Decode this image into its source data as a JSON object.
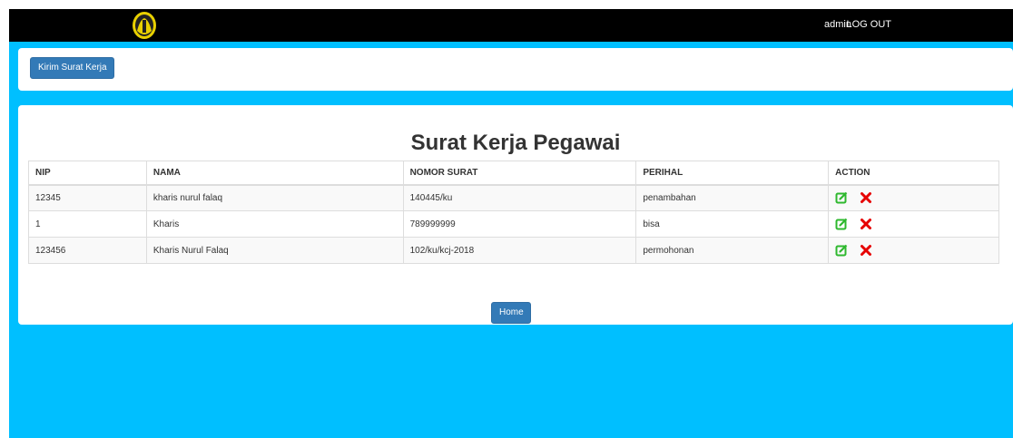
{
  "navbar": {
    "user_label": "admin",
    "logout_label": "LOG OUT"
  },
  "toolbar": {
    "kirim_label": "Kirim Surat Kerja"
  },
  "main": {
    "title": "Surat Kerja Pegawai",
    "columns": [
      "NIP",
      "NAMA",
      "NOMOR SURAT",
      "PERIHAL",
      "ACTION"
    ],
    "rows": [
      {
        "nip": "12345",
        "nama": "kharis nurul falaq",
        "nomor": "140445/ku",
        "perihal": "penambahan"
      },
      {
        "nip": "1",
        "nama": "Kharis",
        "nomor": "789999999",
        "perihal": "bisa"
      },
      {
        "nip": "123456",
        "nama": "Kharis Nurul Falaq",
        "nomor": "102/ku/kcj-2018",
        "perihal": "permohonan"
      }
    ],
    "home_label": "Home"
  },
  "icons": {
    "logo": "emblem-logo",
    "edit": "edit-icon",
    "delete": "delete-icon"
  },
  "colors": {
    "background": "#00bfff",
    "navbar": "#000000",
    "primary_button": "#337ab7",
    "edit_icon": "#2eb82e",
    "delete_icon": "#e60000"
  }
}
